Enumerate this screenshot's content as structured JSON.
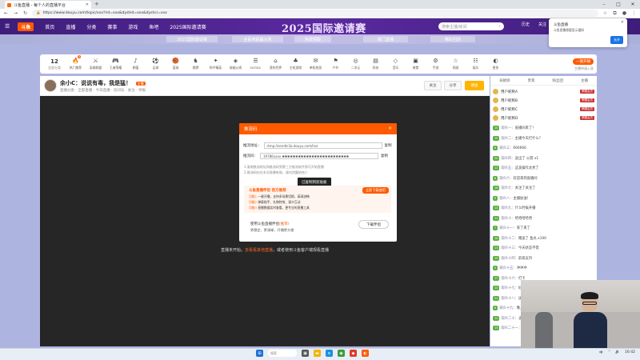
{
  "browser": {
    "tab_title": "斗鱼直播 - 每个人的直播平台",
    "new_tab": "+",
    "url": "https://www.douyu.com/topic/xxx?rid=xxx&dyshid=xxx&dyshci=xxx",
    "window_controls": [
      "–",
      "□",
      "✕"
    ]
  },
  "site": {
    "logo": "斗鱼",
    "nav": [
      "首页",
      "直播",
      "分类",
      "赛事",
      "游戏",
      "鱼吧",
      "2025国际邀请赛"
    ],
    "banner_title": "2025国际邀请赛",
    "search_placeholder": "搜索主播/房间",
    "nav_right": [
      "历史",
      "关注",
      "消息",
      "创作",
      "登录"
    ],
    "sub_chips": [
      "2025国际邀请赛",
      "全民竞猜赢大奖",
      "免费领取",
      "热门直播",
      "精彩回放"
    ]
  },
  "category_bar": {
    "count": "12",
    "count_label": "全部分类",
    "items": [
      {
        "icon": "🔥",
        "label": "热门推荐",
        "badge": "9"
      },
      {
        "icon": "⚔",
        "label": "英雄联盟"
      },
      {
        "icon": "🎮",
        "label": "王者荣耀"
      },
      {
        "icon": "♪",
        "label": "颜值"
      },
      {
        "icon": "⚽",
        "label": "足球"
      },
      {
        "icon": "🏀",
        "label": "篮球"
      },
      {
        "icon": "♞",
        "label": "棋牌"
      },
      {
        "icon": "✦",
        "label": "和平精英"
      },
      {
        "icon": "◈",
        "label": "穿越火线"
      },
      {
        "icon": "☰",
        "label": "DOTA2"
      },
      {
        "icon": "⌂",
        "label": "我的世界"
      },
      {
        "icon": "♣",
        "label": "主机游戏"
      },
      {
        "icon": "✉",
        "label": "单机热游"
      },
      {
        "icon": "⚑",
        "label": "户外"
      },
      {
        "icon": "◎",
        "label": "二次元"
      },
      {
        "icon": "▤",
        "label": "科技"
      },
      {
        "icon": "◇",
        "label": "音乐"
      },
      {
        "icon": "▣",
        "label": "美食"
      },
      {
        "icon": "⚙",
        "label": "手游"
      },
      {
        "icon": "☆",
        "label": "网游"
      },
      {
        "icon": "☷",
        "label": "娱乐"
      },
      {
        "icon": "◐",
        "label": "更多"
      }
    ],
    "right_button": "一键开播",
    "right_link": "主播申请入驻"
  },
  "player": {
    "title": "余小C：说说有毒，我是猛！",
    "title_tag": "主播",
    "meta": "直播分类 · 全部直播 · 今日直播 · 房间号 · 关注 · 举报",
    "buttons": [
      "关注",
      "分享",
      "赠送"
    ],
    "hint_prefix": "直播未开始，",
    "hint_link": "去看看其他直播",
    "hint_suffix": "，或者使用斗鱼客户端观看直播"
  },
  "dialog": {
    "title": "推流码",
    "close": "✕",
    "row1_label": "推流地址：",
    "row1_value": "rtmp://sendtc3a.douyu.com/live",
    "row1_action": "复制",
    "row2_label": "推流码：",
    "row2_value": "19786xxxx  ✱✱✱✱✱✱✱✱✱✱✱✱✱✱✱✱✱✱✱✱✱✱✱✱✱",
    "row2_action": "复制",
    "note1": "1.复制推流地址和推流码到第三方推流软件即可开始直播",
    "note2": "2.推流码仅在本次直播有效，请勿泄露给他人",
    "tooltip": "已复制到剪贴板",
    "promo_head": "斗鱼直播伴侣 官方推荐",
    "promo_btn": "立即下载使用",
    "promo_lines": [
      {
        "tag": "功能1",
        "text": "一键开播，支持多场景切换，高清流畅"
      },
      {
        "tag": "功能2",
        "text": "弹幕助手、礼物特效、观众互动"
      },
      {
        "tag": "功能3",
        "text": "直播数据实时查看，更专业的直播工具"
      }
    ],
    "foot1_prefix": "使用斗鱼直播伴侣",
    "foot1_tag": "(推荐)",
    "foot2": "更稳定、更清晰，开播更方便",
    "download_btn": "下载伴侣"
  },
  "chat": {
    "tabs": [
      "贡献榜",
      "贵宾",
      "粉丝团",
      "主播"
    ],
    "ranks": [
      {
        "name": "用户昵称A",
        "tag": "荣耀会员"
      },
      {
        "name": "用户昵称B",
        "tag": "荣耀会员"
      },
      {
        "name": "用户昵称C",
        "tag": "荣耀会员"
      },
      {
        "name": "用户昵称D",
        "tag": "荣耀会员"
      }
    ],
    "messages": [
      {
        "lv": "10",
        "name": "观众一：",
        "text": "直播间来了！"
      },
      {
        "lv": "15",
        "name": "观众二：",
        "text": "主播今天打什么？"
      },
      {
        "lv": "8",
        "name": "观众三：",
        "text": "666666"
      },
      {
        "lv": "20",
        "name": "观众四：",
        "text": "送出了 火箭 x1"
      },
      {
        "lv": "12",
        "name": "观众五：",
        "text": "这波操作太秀了"
      },
      {
        "lv": "6",
        "name": "观众六：",
        "text": "欢迎来到直播间"
      },
      {
        "lv": "18",
        "name": "观众七：",
        "text": "关注了关注了"
      },
      {
        "lv": "9",
        "name": "观众八：",
        "text": "主播加油！"
      },
      {
        "lv": "14",
        "name": "观众九：",
        "text": "什么时候开播"
      },
      {
        "lv": "11",
        "name": "观众十：",
        "text": "哈哈哈哈哈"
      },
      {
        "lv": "7",
        "name": "观众十一：",
        "text": "来了来了"
      },
      {
        "lv": "16",
        "name": "观众十二：",
        "text": "赠送了 鱼丸 x100"
      },
      {
        "lv": "13",
        "name": "观众十三：",
        "text": "今天状态不错"
      },
      {
        "lv": "19",
        "name": "观众十四：",
        "text": "前排支持"
      },
      {
        "lv": "5",
        "name": "观众十五：",
        "text": "冲冲冲"
      },
      {
        "lv": "17",
        "name": "观众十六：",
        "text": "打卡"
      },
      {
        "lv": "10",
        "name": "观众十七：",
        "text": "好耶"
      },
      {
        "lv": "21",
        "name": "观众十八：",
        "text": "送出了 飞机 x1"
      },
      {
        "lv": "8",
        "name": "观众十九：",
        "text": "晚上好"
      },
      {
        "lv": "12",
        "name": "观众二十：",
        "text": "支持主播"
      },
      {
        "lv": "15",
        "name": "观众二十一：",
        "text": "666"
      }
    ]
  },
  "toast": {
    "title": "斗鱼直播",
    "text": "斗鱼直播想要显示通知",
    "close": "✕",
    "button": "允许"
  },
  "taskbar": {
    "search": "搜索",
    "tray": [
      "中",
      "⌃",
      "🔊",
      "16:42"
    ]
  },
  "colors": {
    "accent": "#ff5a00",
    "nav_bg": "#3e1d7a",
    "page_bg": "#aeb4e0",
    "player_bg": "#262626"
  }
}
